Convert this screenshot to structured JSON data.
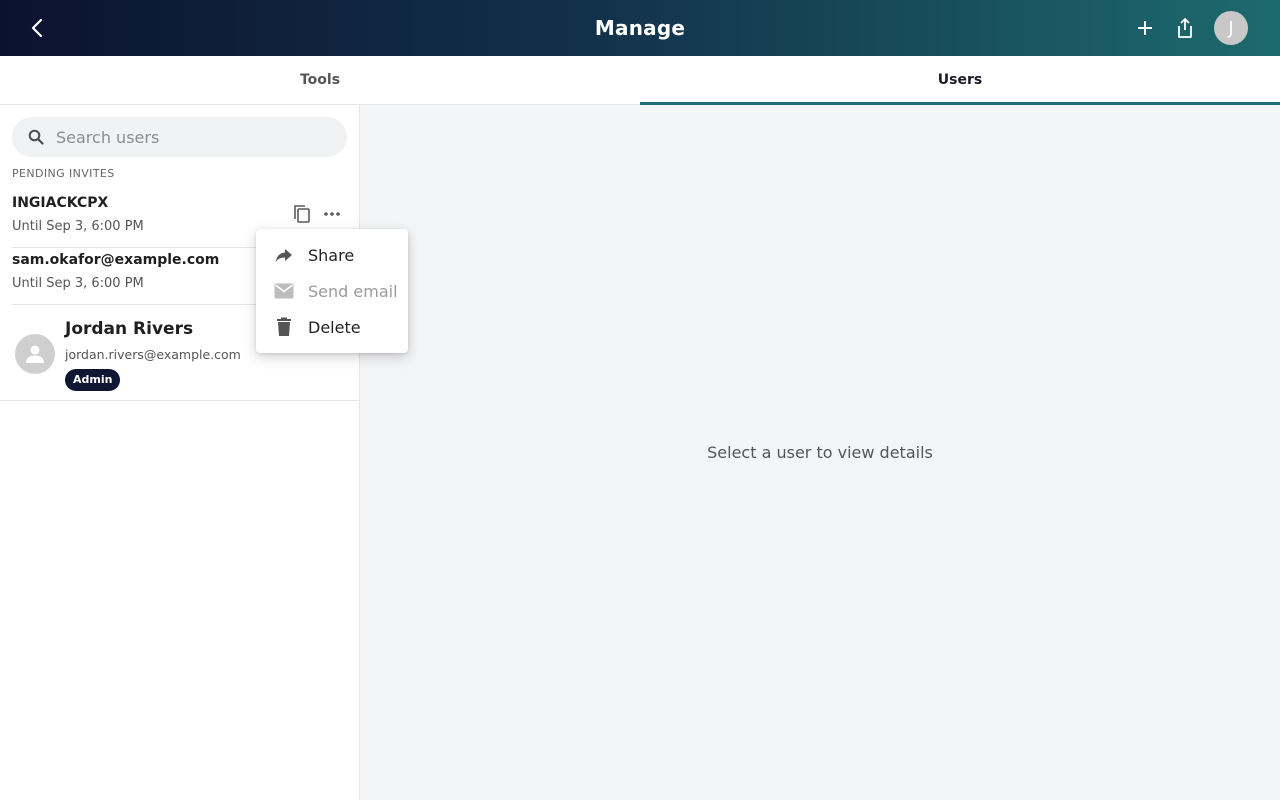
{
  "header": {
    "title": "Manage",
    "avatar_initial": "J",
    "colors": {
      "gradient_start": "#0b1230",
      "gradient_end": "#1d6a6e"
    }
  },
  "tabs": [
    {
      "label": "Tools",
      "active": false
    },
    {
      "label": "Users",
      "active": true
    }
  ],
  "search": {
    "placeholder": "Search users",
    "value": ""
  },
  "sidebar": {
    "section_label": "PENDING INVITES",
    "invites": [
      {
        "name": "INGIACKCPX",
        "until": "Until Sep 3, 6:00 PM"
      },
      {
        "name": "sam.okafor@example.com",
        "until": "Until Sep 3, 6:00 PM"
      }
    ],
    "users": [
      {
        "name": "Jordan Rivers",
        "email": "jordan.rivers@example.com",
        "role": "Admin"
      }
    ]
  },
  "main": {
    "empty_text": "Select a user to view details"
  },
  "context_menu": {
    "items": [
      {
        "label": "Share",
        "icon": "share-icon",
        "disabled": false
      },
      {
        "label": "Send email",
        "icon": "email-icon",
        "disabled": true
      },
      {
        "label": "Delete",
        "icon": "trash-icon",
        "disabled": false
      }
    ]
  },
  "icons": {
    "back": "chevron-left-icon",
    "add": "plus-icon",
    "share": "upload-share-icon",
    "copy": "copy-icon",
    "more": "more-horizontal-icon"
  }
}
